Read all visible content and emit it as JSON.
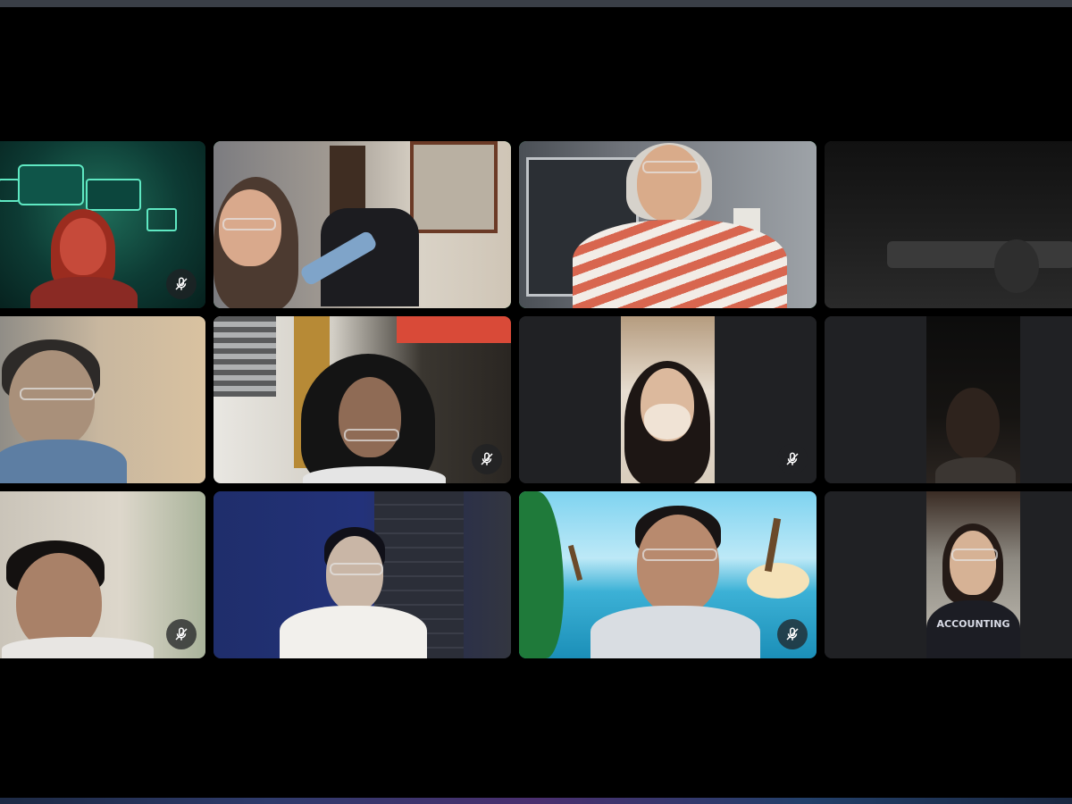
{
  "window": {
    "active_speakers": [
      "participant-2",
      "participant-3"
    ]
  },
  "participants": [
    {
      "id": "participant-1",
      "muted": true,
      "background": "virtual-tech-green"
    },
    {
      "id": "participant-2",
      "muted": false,
      "speaking": true
    },
    {
      "id": "participant-3",
      "muted": false,
      "speaking": true
    },
    {
      "id": "participant-4",
      "muted": false,
      "camera": "dark"
    },
    {
      "id": "participant-5",
      "muted": false
    },
    {
      "id": "participant-6",
      "muted": true
    },
    {
      "id": "participant-7",
      "muted": true
    },
    {
      "id": "participant-8",
      "muted": false,
      "camera": "dark"
    },
    {
      "id": "participant-9",
      "muted": true
    },
    {
      "id": "participant-10",
      "muted": false
    },
    {
      "id": "participant-11",
      "muted": true,
      "background": "virtual-beach"
    },
    {
      "id": "participant-12",
      "muted": false
    }
  ],
  "visible_text": {
    "shirt_text": "ACCOUNTING"
  },
  "icons": {
    "mute": "mic-off-icon"
  },
  "colors": {
    "speaking_border": "#3cd070",
    "tile_bg": "#202124",
    "stage_bg": "#000000"
  }
}
